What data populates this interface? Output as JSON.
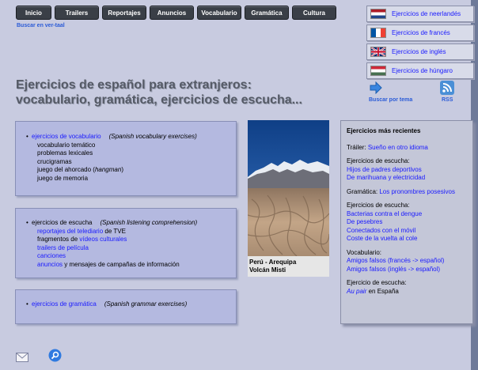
{
  "nav": [
    "Inicio",
    "Trailers",
    "Reportajes",
    "Anuncios",
    "Vocabulario",
    "Gramática",
    "Cultura"
  ],
  "buscar_vertaal": "Buscar en ver-taal",
  "languages": [
    {
      "label": "Ejercicios de neerlandés",
      "flag": "netherlands-flag-icon"
    },
    {
      "label": "Ejercicios de francés",
      "flag": "france-flag-icon"
    },
    {
      "label": "Ejercicios de inglés",
      "flag": "uk-flag-icon"
    },
    {
      "label": "Ejercicios de húngaro",
      "flag": "hungary-flag-icon"
    }
  ],
  "title_line1": "Ejercicios de español para extranjeros:",
  "title_line2": "vocabulario, gramática, ejercicios de escucha...",
  "tools": {
    "search": "Buscar por tema",
    "rss": "RSS"
  },
  "panel_vocab": {
    "head": "ejercicios de vocabulario",
    "note": "(Spanish vocabulary exercises)",
    "items": [
      "vocabulario temático",
      "problemas lexicales",
      "crucigramas"
    ],
    "hangman_pre": "juego del ahorcado (",
    "hangman_em": "hangman",
    "hangman_post": ")",
    "memory": "juego de memoria"
  },
  "panel_listen": {
    "head": "ejercicios de escucha",
    "note": "(Spanish listening comprehension)",
    "l1_link": "reportajes del telediario",
    "l1_text": " de TVE",
    "l2_text": "fragmentos de ",
    "l2_link": "vídeos culturales",
    "l3_link": "trailers de película",
    "l4_link": "canciones",
    "l5_link": "anuncios",
    "l5_text": " y mensajes de campañas de información"
  },
  "panel_gram": {
    "head": "ejercicios de gramática",
    "note": "(Spanish grammar exercises)"
  },
  "photo_caption": [
    "Perú - Arequipa",
    "Volcán Misti"
  ],
  "recent": {
    "title": "Ejercicios más recientes",
    "trailer_label": "Tráiler: ",
    "trailer_link": "Sueño en otro idioma",
    "escucha1_label": "Ejercicios de escucha:",
    "escucha1_links": [
      "Hijos de padres deportivos",
      "De marihuana y electricidad"
    ],
    "gram_label": "Gramática: ",
    "gram_link": "Los pronombres posesivos",
    "escucha2_label": "Ejercicios de escucha:",
    "escucha2_links": [
      "Bacterias contra el dengue",
      "De pesebres",
      "Conectados con el móvil",
      "Coste de la vuelta al cole"
    ],
    "vocab_label": "Vocabulario:",
    "vocab_links": [
      "Amigos falsos (francés -> español)",
      "Amigos falsos (inglés -> español)"
    ],
    "escucha3_label": "Ejercicio de escucha:",
    "aupair_link": "Au pair",
    "aupair_text": " en España"
  }
}
